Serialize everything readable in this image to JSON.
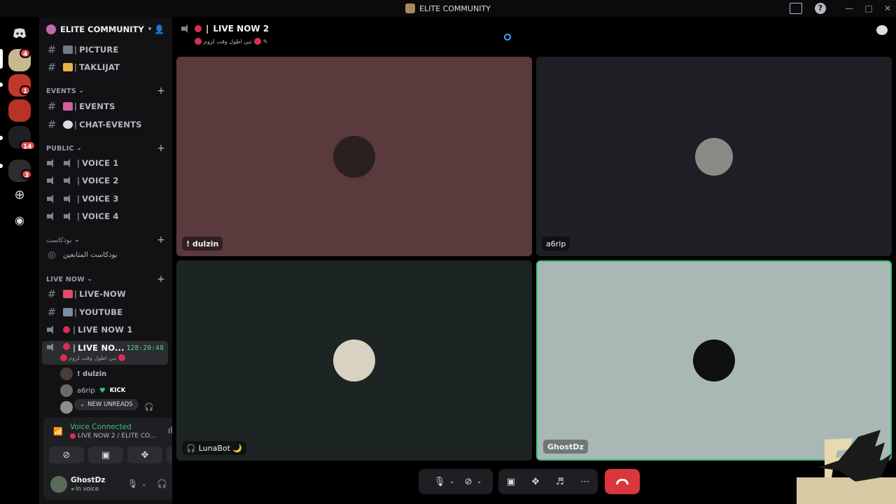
{
  "window": {
    "title": "ELITE COMMUNITY"
  },
  "rail": {
    "badges": [
      "4",
      "1",
      "14",
      "3"
    ]
  },
  "guild": {
    "name": "ELITE COMMUNITY"
  },
  "channels": {
    "picture": "PICTURE",
    "taklijat": "TAKLIJAT",
    "cat_events": "EVENTS",
    "events": "EVENTS",
    "chat_events": "CHAT-EVENTS",
    "cat_public": "PUBLIC",
    "voice1": "VOICE 1",
    "voice2": "VOICE 2",
    "voice3": "VOICE 3",
    "voice4": "VOICE 4",
    "cat_podcast": "بودكاست",
    "podcast_stage": "بودكاست المتابعين",
    "cat_live": "LIVE NOW",
    "live_now": "LIVE-NOW",
    "youtube": "YOUTUBE",
    "live_now_1": "LIVE NOW 1",
    "live_now_2_short": "LIVE NO...",
    "live_now_2_timer": "128:20:48",
    "live_now_2_status": "تبي اطول وقت لزوم"
  },
  "voice_members": [
    {
      "name": "! dulzin"
    },
    {
      "name": "a6rip",
      "tag": "KICK"
    },
    {
      "name": ""
    }
  ],
  "unreads_label": "NEW UNREADS",
  "panel": {
    "status": "Voice Connected",
    "channel": "LIVE NOW 2 / ELITE CO...",
    "user_name": "GhostDz",
    "user_status": "In voice"
  },
  "stage": {
    "title": "LIVE NOW 2",
    "status": "تبي اطول وقت لزوم"
  },
  "tiles": [
    {
      "name": "! dulzin",
      "bg": "#5a3a3d"
    },
    {
      "name": "a6rip",
      "bg": "#1e1f24"
    },
    {
      "name": "LunaBot 🌙",
      "bg": "#1d2424"
    },
    {
      "name": "GhostDz",
      "bg": "#a9b8b4"
    }
  ],
  "colors": {
    "accent_green": "#3fbf77",
    "danger": "#da373c",
    "live_red": "#da2e51"
  },
  "icons": [
    "discord-icon",
    "add-server-icon",
    "discover-icon",
    "inbox-icon",
    "help-icon",
    "invite-icon",
    "chat-icon",
    "mic-icon",
    "camera-off-icon",
    "screen-share-icon",
    "activities-icon",
    "soundboard-icon",
    "more-icon",
    "hang-up-icon",
    "headphones-icon",
    "settings-icon"
  ]
}
